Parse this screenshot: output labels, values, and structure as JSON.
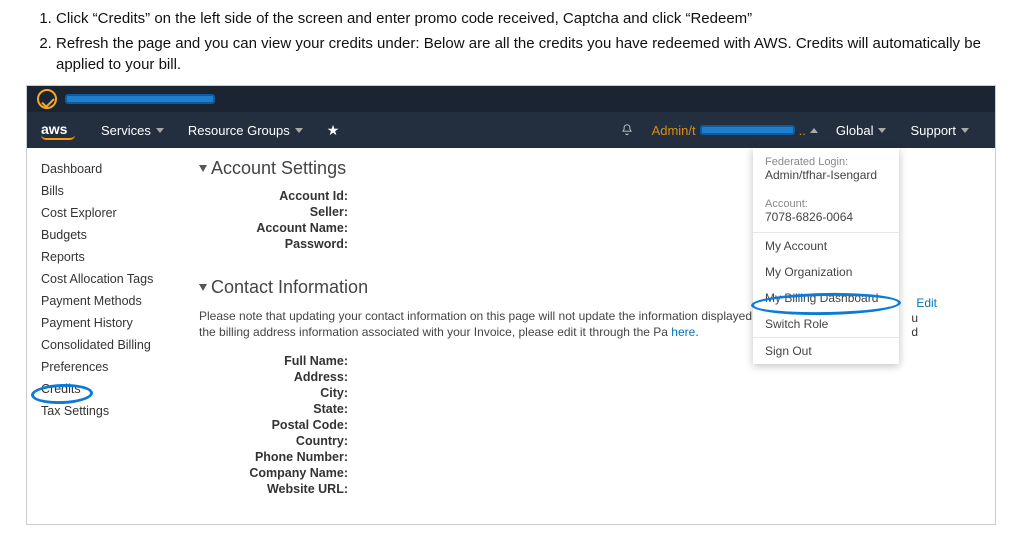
{
  "instructions": {
    "item1": "Click “Credits” on the left side of the screen and enter promo code received, Captcha and click “Redeem”",
    "item2": "Refresh the page and you can view your credits under: Below are all the credits you have redeemed with AWS. Credits will automatically be applied to your bill."
  },
  "topnav": {
    "logo": "aws",
    "services": "Services",
    "resource_groups": "Resource Groups",
    "admin_prefix": "Admin/t",
    "global": "Global",
    "support": "Support"
  },
  "sidebar": {
    "items": [
      "Dashboard",
      "Bills",
      "Cost Explorer",
      "Budgets",
      "Reports",
      "Cost Allocation Tags",
      "Payment Methods",
      "Payment History",
      "Consolidated Billing",
      "Preferences",
      "Credits",
      "Tax Settings"
    ]
  },
  "main": {
    "account_settings_title": "Account Settings",
    "fields1": {
      "account_id": "Account Id:",
      "seller": "Seller:",
      "account_name": "Account Name:",
      "password": "Password:"
    },
    "contact_title": "Contact Information",
    "contact_note_1": "Please note that updating your contact information on this page will not update the information displayed",
    "contact_note_2": "wish to update the billing address information associated with your Invoice, please edit it through the Pa",
    "contact_note_here": "here",
    "contact_note_dot": ".",
    "fields2": {
      "full_name": "Full Name:",
      "address": "Address:",
      "city": "City:",
      "state": "State:",
      "postal": "Postal Code:",
      "country": "Country:",
      "phone": "Phone Number:",
      "company": "Company Name:",
      "website": "Website URL:"
    },
    "edit": "Edit",
    "leak_u": "u",
    "leak_d": "d"
  },
  "acct_panel": {
    "fed_login_label": "Federated Login:",
    "fed_login_value": "Admin/tfhar-Isengard",
    "account_label": "Account:",
    "account_value": "7078-6826-0064",
    "my_account": "My Account",
    "my_org": "My Organization",
    "my_billing": "My Billing Dashboard",
    "switch_role": "Switch Role",
    "sign_out": "Sign Out"
  }
}
